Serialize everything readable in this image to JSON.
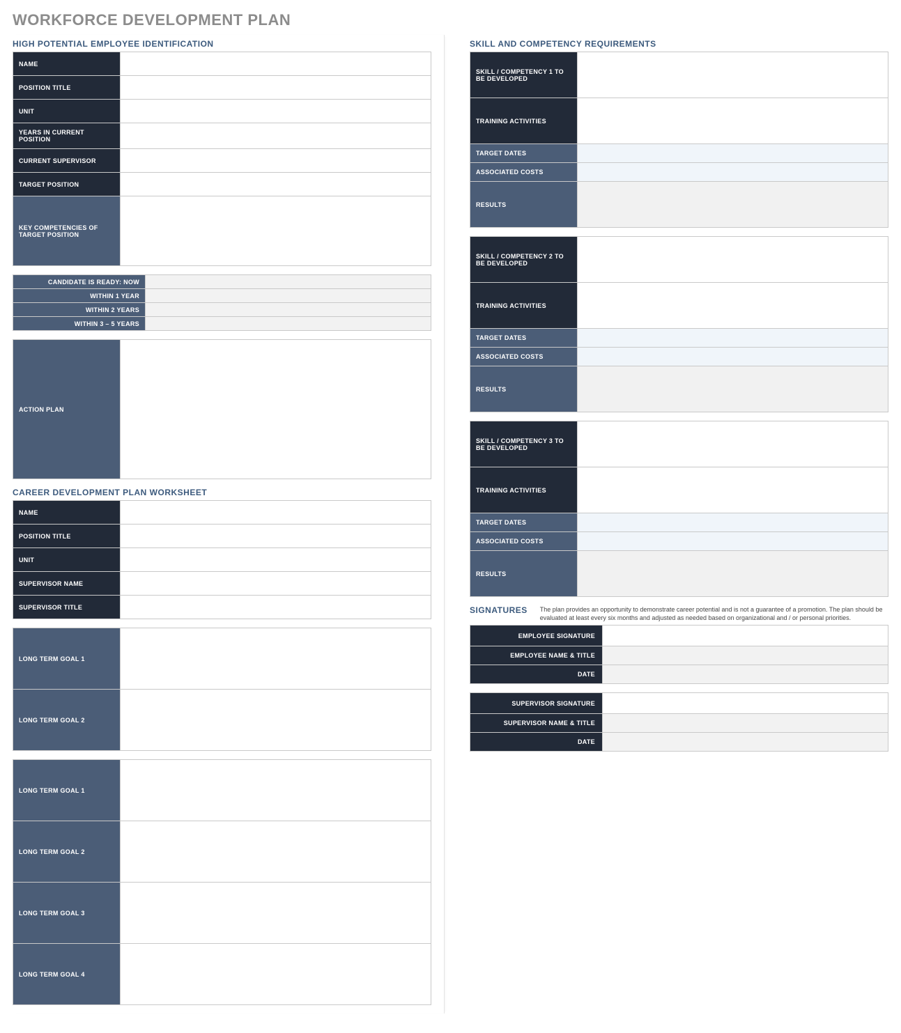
{
  "page_title": "WORKFORCE DEVELOPMENT PLAN",
  "left": {
    "hp": {
      "title": "HIGH POTENTIAL EMPLOYEE IDENTIFICATION",
      "rows": {
        "name": "NAME",
        "position_title": "POSITION TITLE",
        "unit": "UNIT",
        "years": "YEARS IN CURRENT POSITION",
        "supervisor": "CURRENT SUPERVISOR",
        "target_position": "TARGET POSITION",
        "key_comp": "KEY COMPETENCIES OF TARGET POSITION"
      },
      "values": {
        "name": "",
        "position_title": "",
        "unit": "",
        "years": "",
        "supervisor": "",
        "target_position": "",
        "key_comp": ""
      },
      "ready": {
        "now": "CANDIDATE IS READY:  NOW",
        "y1": "WITHIN 1 YEAR",
        "y2": "WITHIN 2 YEARS",
        "y35": "WITHIN 3 – 5 YEARS",
        "v_now": "",
        "v_y1": "",
        "v_y2": "",
        "v_y35": ""
      },
      "action": {
        "label": "ACTION PLAN",
        "value": ""
      }
    },
    "career": {
      "title": "CAREER DEVELOPMENT PLAN WORKSHEET",
      "rows": {
        "name": "NAME",
        "position_title": "POSITION TITLE",
        "unit": "UNIT",
        "sup_name": "SUPERVISOR NAME",
        "sup_title": "SUPERVISOR TITLE"
      },
      "values": {
        "name": "",
        "position_title": "",
        "unit": "",
        "sup_name": "",
        "sup_title": ""
      },
      "ltA": {
        "g1": "LONG TERM GOAL 1",
        "g2": "LONG TERM GOAL 2",
        "v1": "",
        "v2": ""
      },
      "ltB": {
        "g1": "LONG TERM GOAL 1",
        "g2": "LONG TERM GOAL 2",
        "g3": "LONG TERM GOAL 3",
        "g4": "LONG TERM GOAL 4",
        "v1": "",
        "v2": "",
        "v3": "",
        "v4": ""
      }
    }
  },
  "right": {
    "skills": {
      "title": "SKILL AND COMPETENCY REQUIREMENTS",
      "labels": {
        "sc1": "SKILL / COMPETENCY 1 TO BE DEVELOPED",
        "sc2": "SKILL / COMPETENCY 2 TO BE DEVELOPED",
        "sc3": "SKILL / COMPETENCY 3 TO BE DEVELOPED",
        "training": "TRAINING ACTIVITIES",
        "dates": "TARGET DATES",
        "costs": "ASSOCIATED COSTS",
        "results": "RESULTS"
      },
      "b1": {
        "sc": "",
        "training": "",
        "dates": "",
        "costs": "",
        "results": ""
      },
      "b2": {
        "sc": "",
        "training": "",
        "dates": "",
        "costs": "",
        "results": ""
      },
      "b3": {
        "sc": "",
        "training": "",
        "dates": "",
        "costs": "",
        "results": ""
      }
    },
    "sig": {
      "title": "SIGNATURES",
      "note": "The plan provides an opportunity to demonstrate career potential and is not a guarantee of a promotion. The plan should be evaluated at least every six months and adjusted as needed based on organizational and / or personal priorities.",
      "emp": {
        "sig": "EMPLOYEE SIGNATURE",
        "name": "EMPLOYEE NAME & TITLE",
        "date": "DATE",
        "v_sig": "",
        "v_name": "",
        "v_date": ""
      },
      "sup": {
        "sig": "SUPERVISOR SIGNATURE",
        "name": "SUPERVISOR NAME & TITLE",
        "date": "DATE",
        "v_sig": "",
        "v_name": "",
        "v_date": ""
      }
    }
  }
}
